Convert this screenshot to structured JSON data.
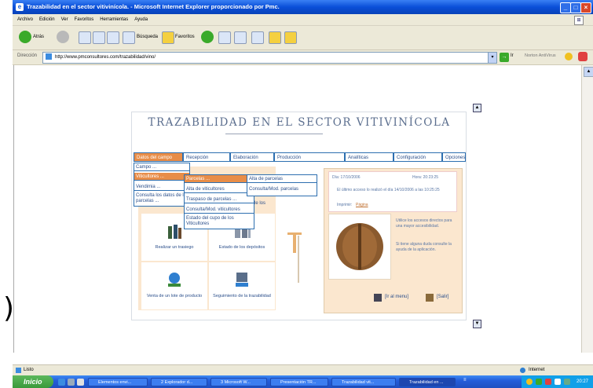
{
  "window": {
    "title": "Trazabilidad en el sector vitivinícola. - Microsoft Internet Explorer proporcionado por Pmc.",
    "menu": [
      "Archivo",
      "Edición",
      "Ver",
      "Favoritos",
      "Herramientas",
      "Ayuda"
    ],
    "toolbar": {
      "back": "Atrás",
      "search": "Búsqueda",
      "favorites": "Favoritos"
    },
    "address": {
      "label": "Dirección",
      "url": "http://www.pmconsultores.com/trazabilidad/vino/",
      "go": "Ir",
      "norton": "Norton AntiVirus"
    }
  },
  "page": {
    "title": "TRAZABILIDAD EN EL SECTOR VITIVINÍCOLA",
    "nav": [
      "Datos del campo",
      "Recepción",
      "Elaboración",
      "Producción",
      "Analíticas",
      "Configuración",
      "Opciones"
    ],
    "menu1": [
      "Campo ...",
      "Viticultores ...",
      "Vendimia ...",
      "Consulta los datos de las parcelas ..."
    ],
    "menu2": [
      "Parcelas ...",
      "Alta de viticultores",
      "Traspaso de parcelas ...",
      "Consulta/Mod. viticultores",
      "Estado del cupo de los Viticultores"
    ],
    "menu3": [
      "Alta de parcelas",
      "Consulta/Mod. parcelas"
    ],
    "partial_text": "de los",
    "tiles": [
      "Realizar un trasiego",
      "Estado de los depósitos",
      "Venta de un lote de producto",
      "Seguimiento de la trazabilidad"
    ],
    "info": {
      "date": "Día: 17/10/2006",
      "time": "Hora: 20:23:25",
      "last_access": "El último acceso lo realizó el día 14/10/2006 a las 10:25:25",
      "print_label": "Imprimir:",
      "print_link": "Página"
    },
    "notes": [
      "Utilice los accesos directos para una mayor accesibilidad.",
      "Si tiene alguna duda consulte la ayuda de la aplicación."
    ],
    "footer": {
      "menu": "[Ir al menu]",
      "exit": "[Salir]"
    }
  },
  "statusbar": {
    "left": "Listo",
    "right": "Internet"
  },
  "taskbar": {
    "start": "Inicio",
    "tasks": [
      "Elementos envi...",
      "2 Explorador d...",
      "3 Microsoft W...",
      "Presentación TR...",
      "Trazabilidad vit...",
      "Trazabilidad en ..."
    ],
    "clock": "20:27"
  },
  "colors": {
    "accent": "#e88d48",
    "link": "#2a4e8a",
    "border": "#2d6fb0",
    "panel": "#fbe7cf",
    "titlebar": "#0a4fd8"
  }
}
